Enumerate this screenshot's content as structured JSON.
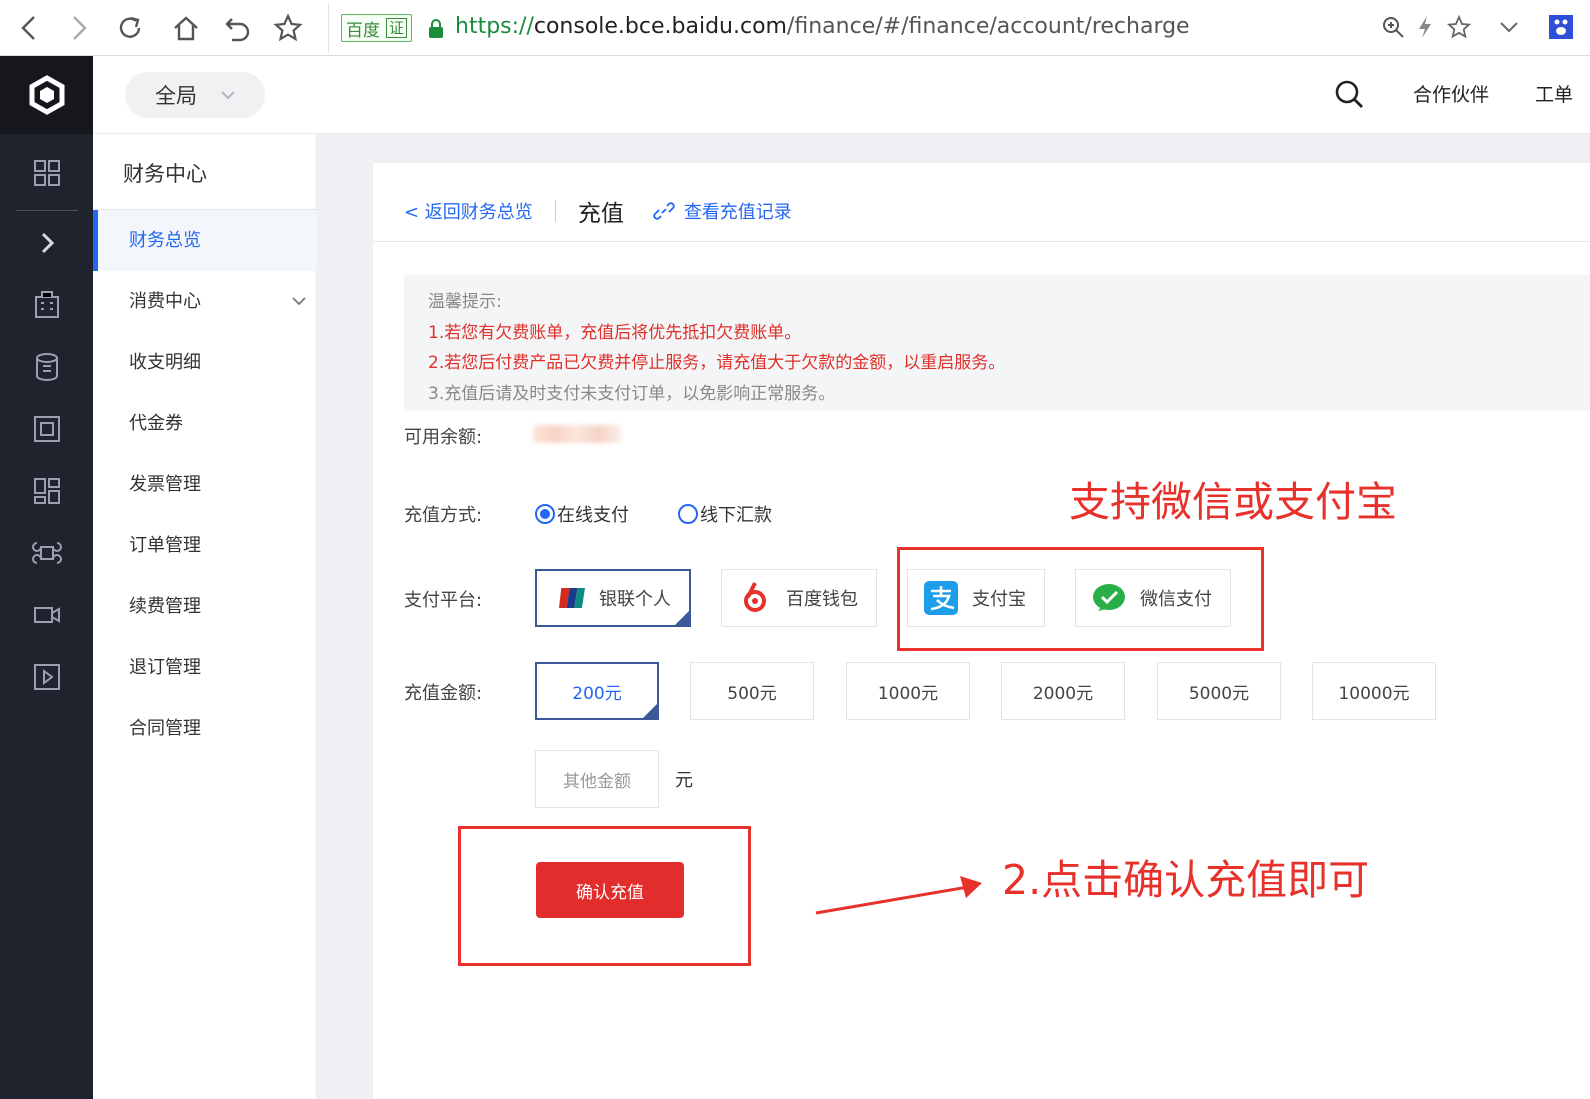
{
  "browser": {
    "url_scheme": "https://",
    "url_host": "console.bce.baidu.com",
    "url_path": "/finance/#/finance/account/recharge",
    "badge_text": "百度",
    "badge_cert": "证"
  },
  "header": {
    "scope_label": "全局",
    "partner_label": "合作伙伴",
    "ticket_label": "工单"
  },
  "sidebar": {
    "title": "财务中心",
    "items": [
      {
        "label": "财务总览",
        "active": true
      },
      {
        "label": "消费中心",
        "has_children": true
      },
      {
        "label": "收支明细"
      },
      {
        "label": "代金券"
      },
      {
        "label": "发票管理"
      },
      {
        "label": "订单管理"
      },
      {
        "label": "续费管理"
      },
      {
        "label": "退订管理"
      },
      {
        "label": "合同管理"
      }
    ]
  },
  "page": {
    "back_link": "< 返回财务总览",
    "title": "充值",
    "history_link": "查看充值记录",
    "tips": {
      "heading": "温馨提示:",
      "line1": "1.若您有欠费账单，充值后将优先抵扣欠费账单。",
      "line2": "2.若您后付费产品已欠费并停止服务，请充值大于欠款的金额，以重启服务。",
      "line3": "3.充值后请及时支付未支付订单，以免影响正常服务。"
    },
    "balance_label": "可用余额:",
    "method_label": "充值方式:",
    "methods": [
      {
        "label": "在线支付",
        "selected": true
      },
      {
        "label": "线下汇款",
        "selected": false
      }
    ],
    "platform_label": "支付平台:",
    "platforms": [
      {
        "label": "银联个人",
        "icon": "unionpay-icon",
        "selected": true
      },
      {
        "label": "百度钱包",
        "icon": "baidu-wallet-icon"
      },
      {
        "label": "支付宝",
        "icon": "alipay-icon"
      },
      {
        "label": "微信支付",
        "icon": "wechat-pay-icon"
      }
    ],
    "amount_label": "充值金额:",
    "amounts": [
      "200元",
      "500元",
      "1000元",
      "2000元",
      "5000元",
      "10000元"
    ],
    "selected_amount": "200元",
    "other_placeholder": "其他金额",
    "unit": "元",
    "confirm_label": "确认充值"
  },
  "annotations": {
    "note1": "支持微信或支付宝",
    "note2": "2.点击确认充值即可"
  },
  "colors": {
    "accent": "#2468f2",
    "danger": "#e32d2d",
    "annotation": "#e8312b",
    "rail": "#1f232d"
  }
}
